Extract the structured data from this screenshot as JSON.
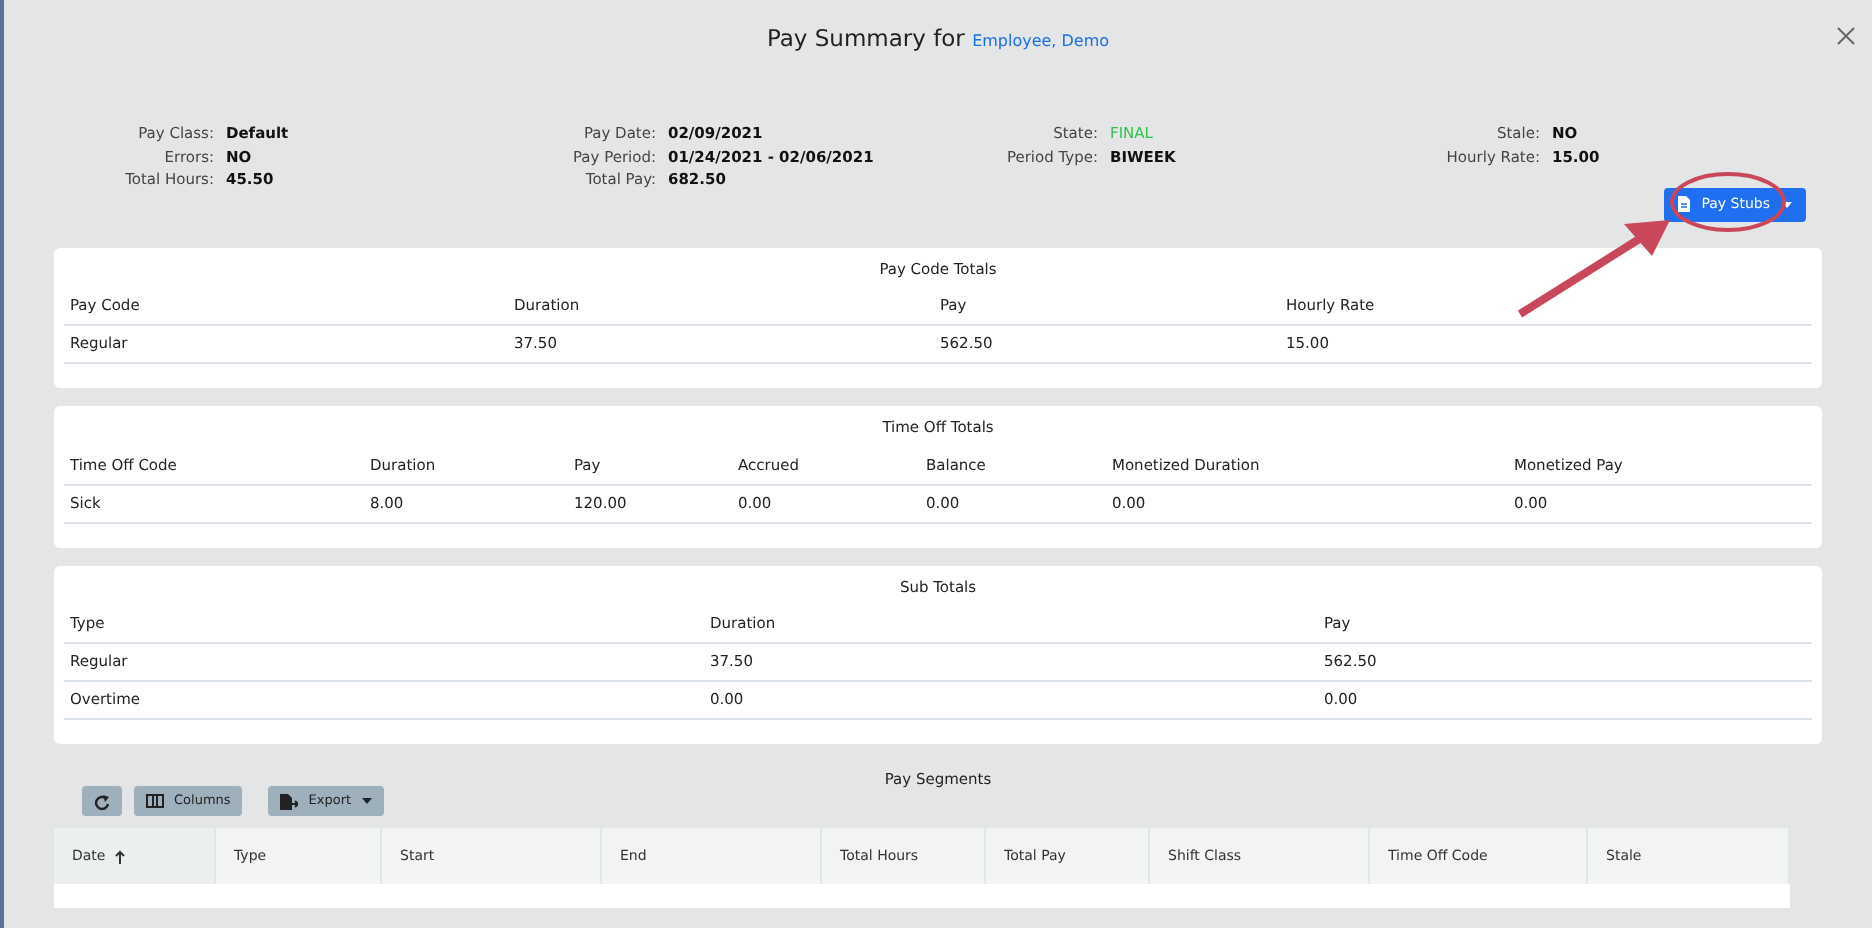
{
  "modal": {
    "title": "Pay Summary for",
    "employee_link": "Employee, Demo"
  },
  "info_columns": [
    {
      "fields": [
        {
          "label": "Pay Class:",
          "value": "Default",
          "highlight": false
        },
        {
          "label": "Errors:",
          "value": "NO",
          "highlight": false
        },
        {
          "label": "Total Hours:",
          "value": "45.50",
          "highlight": false
        }
      ]
    },
    {
      "fields": [
        {
          "label": "Pay Date:",
          "value": "02/09/2021",
          "highlight": false
        },
        {
          "label": "Pay Period:",
          "value": "01/24/2021 - 02/06/2021",
          "highlight": false
        },
        {
          "label": "Total Pay:",
          "value": "682.50",
          "highlight": false
        }
      ]
    },
    {
      "fields": [
        {
          "label": "State:",
          "value": "FINAL",
          "highlight": true
        },
        {
          "label": "Period Type:",
          "value": "BIWEEK",
          "highlight": false
        }
      ]
    },
    {
      "fields": [
        {
          "label": "Stale:",
          "value": "NO",
          "highlight": false
        },
        {
          "label": "Hourly Rate:",
          "value": "15.00",
          "highlight": false
        }
      ]
    }
  ],
  "pay_stubs_button": "Pay Stubs",
  "tables": [
    {
      "title": "Pay Code Totals",
      "columns": [
        "Pay Code",
        "Duration",
        "Pay",
        "Hourly Rate"
      ],
      "rows": [
        [
          "Regular",
          "37.50",
          "562.50",
          "15.00"
        ]
      ]
    },
    {
      "title": "Time Off Totals",
      "columns": [
        "Time Off Code",
        "Duration",
        "Pay",
        "Accrued",
        "Balance",
        "Monetized Duration",
        "Monetized Pay"
      ],
      "rows": [
        [
          "Sick",
          "8.00",
          "120.00",
          "0.00",
          "0.00",
          "0.00",
          "0.00"
        ]
      ]
    },
    {
      "title": "Sub Totals",
      "columns": [
        "Type",
        "Duration",
        "Pay"
      ],
      "rows": [
        [
          "Regular",
          "37.50",
          "562.50"
        ],
        [
          "Overtime",
          "0.00",
          "0.00"
        ]
      ]
    }
  ],
  "pay_segments": {
    "title": "Pay Segments",
    "toolbar": [
      "Columns",
      "Export"
    ],
    "columns": [
      {
        "label": "Date",
        "sorted_ascending": true
      },
      {
        "label": "Type",
        "sorted_ascending": false
      },
      {
        "label": "Start",
        "sorted_ascending": false
      },
      {
        "label": "End",
        "sorted_ascending": false
      },
      {
        "label": "Total Hours",
        "sorted_ascending": false
      },
      {
        "label": "Total Pay",
        "sorted_ascending": false
      },
      {
        "label": "Shift Class",
        "sorted_ascending": false
      },
      {
        "label": "Time Off Code",
        "sorted_ascending": false
      },
      {
        "label": "Stale",
        "sorted_ascending": false
      }
    ]
  }
}
